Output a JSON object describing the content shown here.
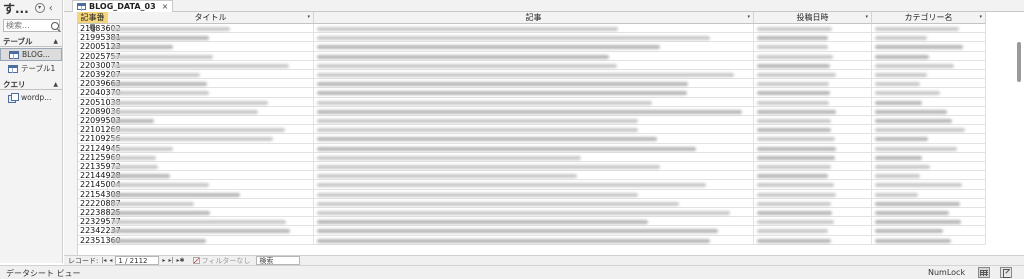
{
  "nav": {
    "title": "す...",
    "search_placeholder": "検索...",
    "groups": [
      {
        "label": "テーブル",
        "items": [
          "BLOG...",
          "テーブル1"
        ]
      },
      {
        "label": "クエリ",
        "items": [
          "wordp..."
        ]
      }
    ]
  },
  "tab": {
    "label": "BLOG_DATA_03",
    "close": "×"
  },
  "columns": [
    "記事番号",
    "タイトル",
    "記事",
    "投稿日時",
    "カテゴリー名"
  ],
  "rows": [
    "21983602",
    "21995381",
    "22005123",
    "22025757",
    "22030071",
    "22039207",
    "22039663",
    "22040370",
    "22051038",
    "22089036",
    "22099503",
    "22101269",
    "22109256",
    "22124945",
    "22125969",
    "22135972",
    "22144928",
    "22145004",
    "22154308",
    "22220887",
    "22238825",
    "22329577",
    "22342237",
    "22351360"
  ],
  "record_nav": {
    "label": "レコード:",
    "first": "|◂",
    "prev": "◂",
    "position": "1 / 2112",
    "next": "▸",
    "last": "▸|",
    "new": "▸✱",
    "filter": "フィルターなし",
    "search": "検索"
  },
  "status": {
    "view": "データシート ビュー",
    "numlock": "NumLock"
  },
  "colors": {
    "active_header": "#f4d57c",
    "accent": "#4d6ea0"
  },
  "icons": {
    "table": "table-icon",
    "query": "query-icon",
    "search": "search-icon"
  }
}
